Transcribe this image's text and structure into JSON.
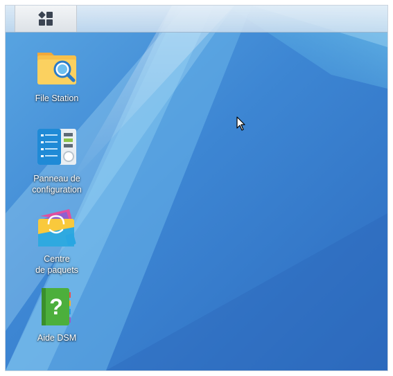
{
  "taskbar": {
    "main_menu_icon": "grid-apps-icon"
  },
  "desktop": {
    "icons": [
      {
        "label": "File Station",
        "icon": "folder-search-icon"
      },
      {
        "label": "Panneau de\nconfiguration",
        "icon": "control-panel-icon"
      },
      {
        "label": "Centre\nde paquets",
        "icon": "shopping-bag-icon"
      },
      {
        "label": "Aide DSM",
        "icon": "help-book-icon"
      }
    ]
  },
  "colors": {
    "wallpaper_dark": "#2f6fc2",
    "wallpaper_light": "#8cd0f0",
    "label_text": "#ffffff"
  }
}
